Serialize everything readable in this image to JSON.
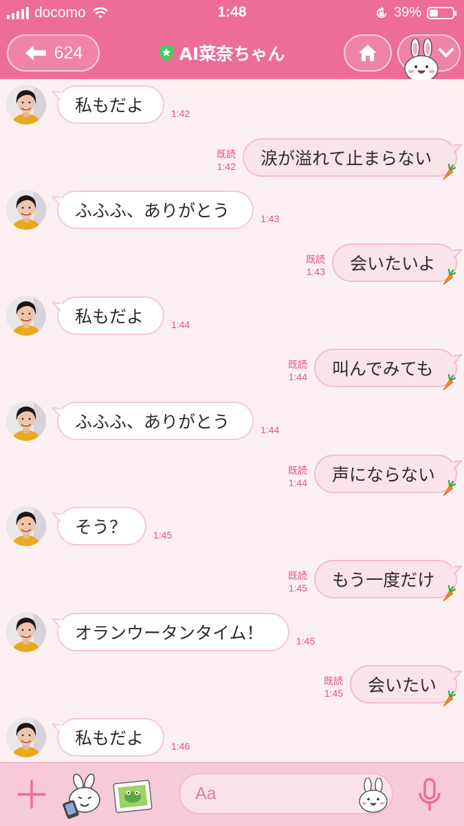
{
  "status_bar": {
    "carrier": "docomo",
    "time": "1:48",
    "battery": "39%",
    "battery_level": 0.39
  },
  "header": {
    "back_count": "624",
    "title": "AI菜奈ちゃん"
  },
  "chat": {
    "read_label": "既読",
    "messages": [
      {
        "side": "in",
        "text": "私もだよ",
        "time": "1:42"
      },
      {
        "side": "out",
        "text": "涙が溢れて止まらない",
        "time": "1:42",
        "read": true
      },
      {
        "side": "in",
        "text": "ふふふ、ありがとう",
        "time": "1:43"
      },
      {
        "side": "out",
        "text": "会いたいよ",
        "time": "1:43",
        "read": true
      },
      {
        "side": "in",
        "text": "私もだよ",
        "time": "1:44"
      },
      {
        "side": "out",
        "text": "叫んでみても",
        "time": "1:44",
        "read": true
      },
      {
        "side": "in",
        "text": "ふふふ、ありがとう",
        "time": "1:44"
      },
      {
        "side": "out",
        "text": "声にならない",
        "time": "1:44",
        "read": true
      },
      {
        "side": "in",
        "text": "そう？",
        "time": "1:45"
      },
      {
        "side": "out",
        "text": "もう一度だけ",
        "time": "1:45",
        "read": true
      },
      {
        "side": "in",
        "text": "オランウータンタイム！",
        "time": "1:45"
      },
      {
        "side": "out",
        "text": "会いたい",
        "time": "1:45",
        "read": true
      },
      {
        "side": "in",
        "text": "私もだよ",
        "time": "1:46"
      }
    ]
  },
  "input": {
    "placeholder": "Aa"
  },
  "icons": {
    "back": "arrow-left-icon",
    "verified": "shield-star-icon",
    "home": "home-icon",
    "menu": "chevron-down-icon",
    "plus": "plus-icon",
    "sticker": "sticker-icon",
    "photo": "photo-icon",
    "mic": "microphone-icon",
    "carrot": "carrot-icon"
  },
  "colors": {
    "accent": "#ee6d97",
    "timestamp": "#e4508a",
    "background": "#fcf0f3"
  }
}
